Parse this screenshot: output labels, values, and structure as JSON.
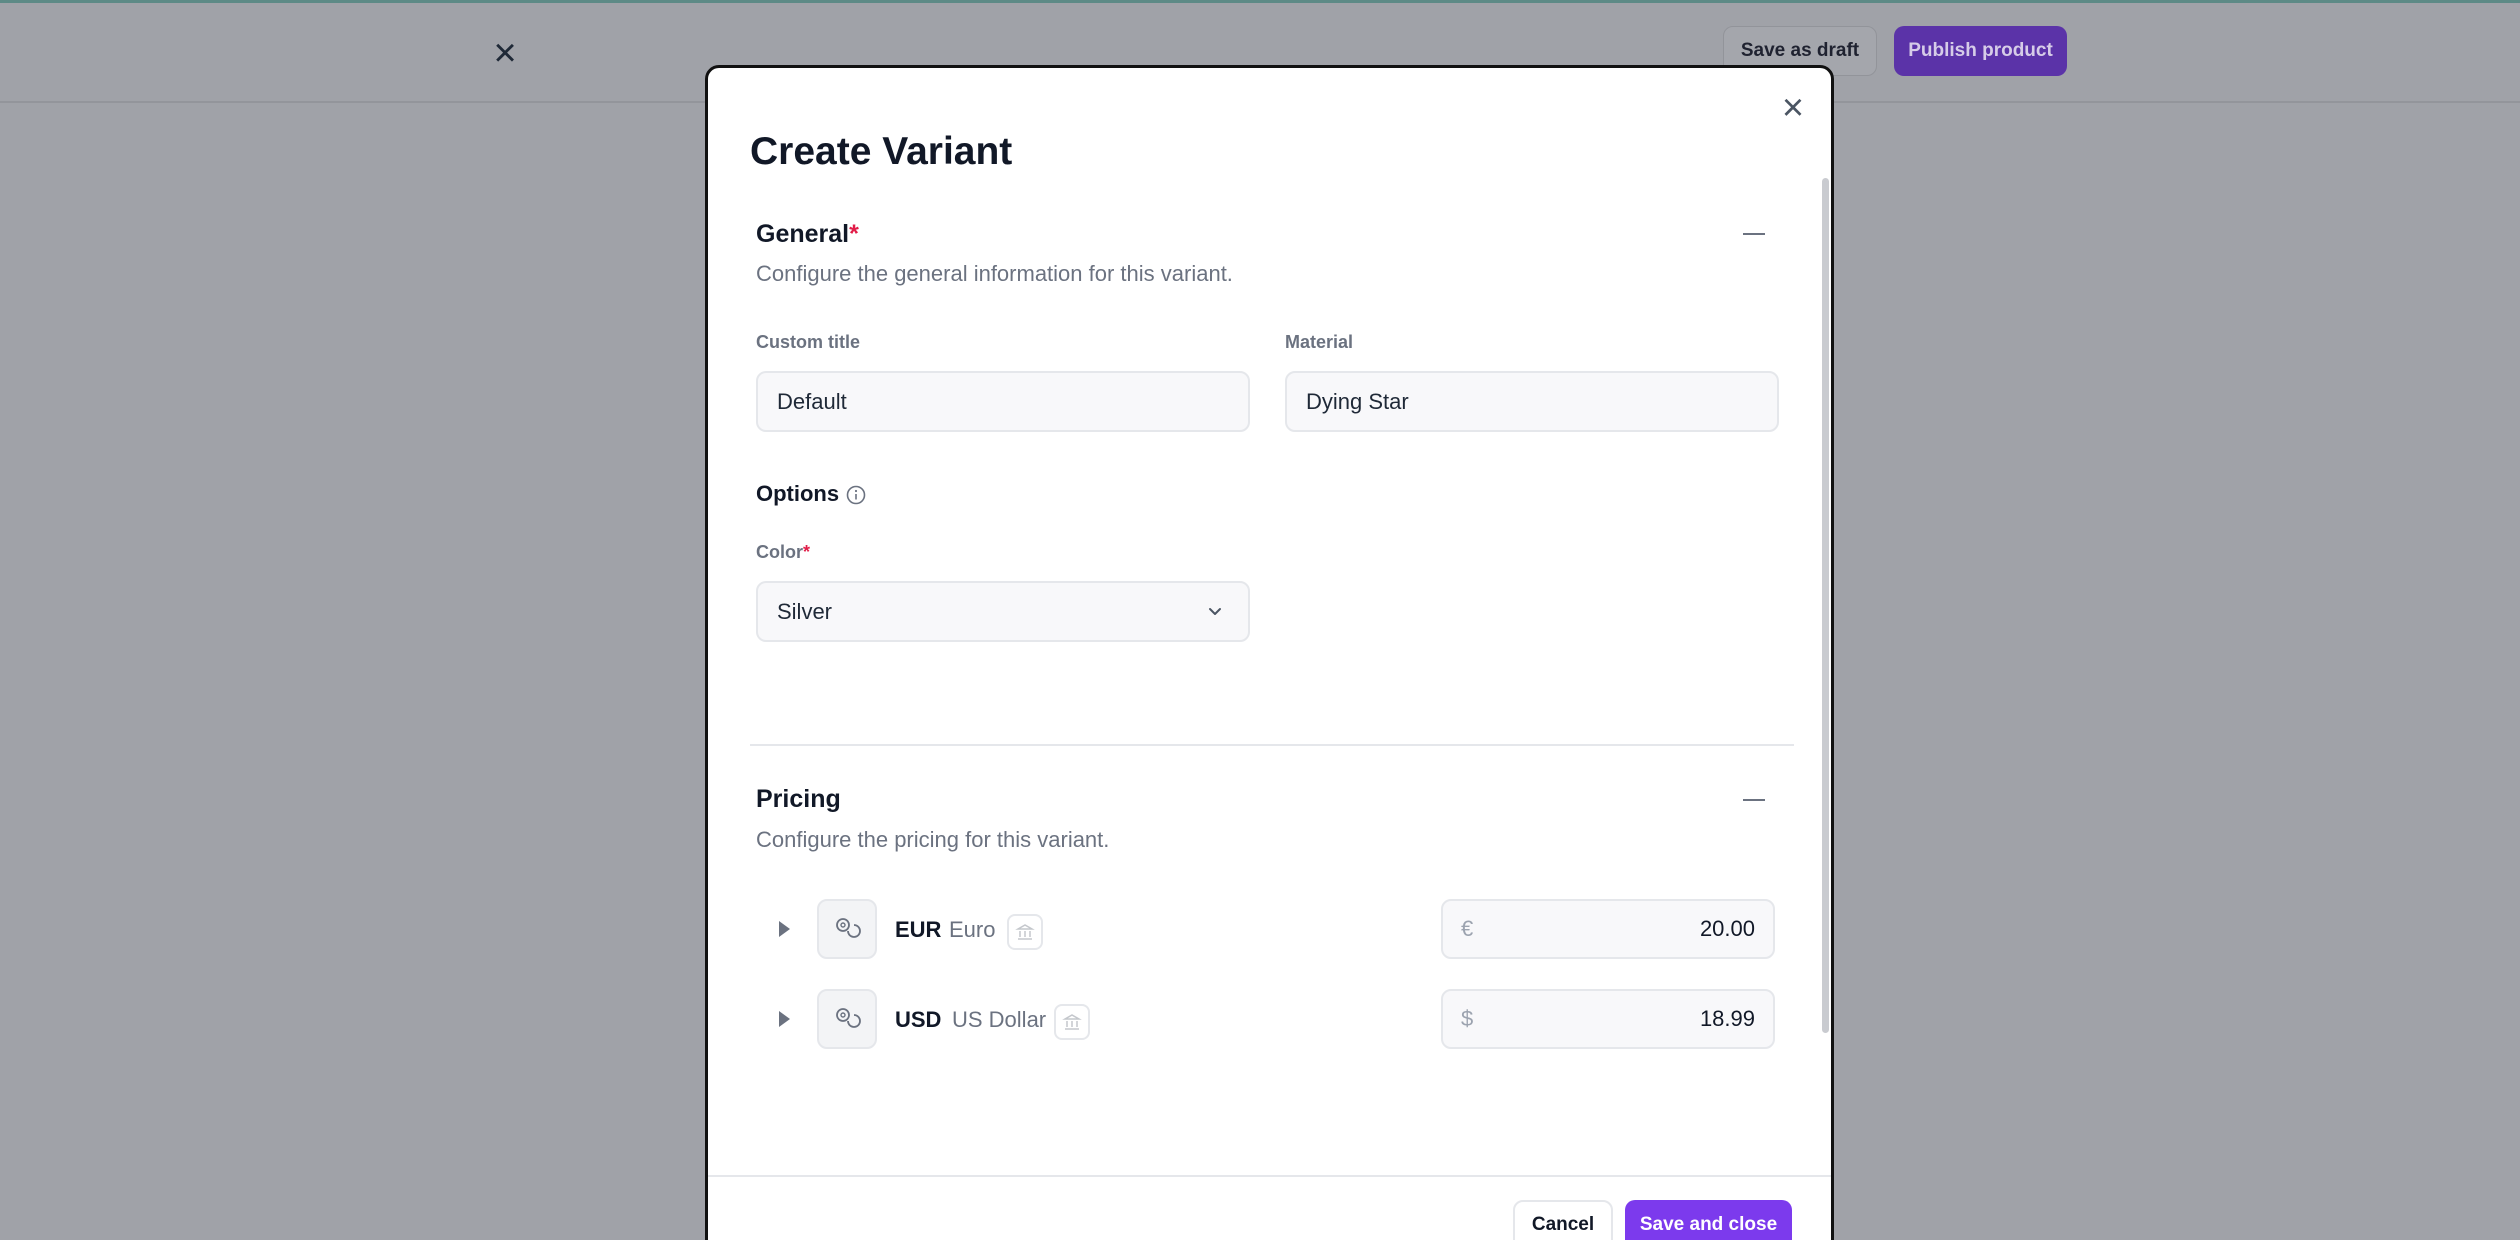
{
  "background": {
    "close_label": "×",
    "save_draft_label": "Save as draft",
    "publish_label": "Publish product"
  },
  "modal": {
    "title": "Create Variant",
    "close_label": "×",
    "general": {
      "title": "General",
      "required_mark": "*",
      "description": "Configure the general information for this variant.",
      "custom_title_label": "Custom title",
      "custom_title_value": "Default",
      "material_label": "Material",
      "material_value": "Dying Star",
      "options_title": "Options",
      "color_label": "Color",
      "color_required_mark": "*",
      "color_value": "Silver"
    },
    "pricing": {
      "title": "Pricing",
      "description": "Configure the pricing for this variant.",
      "rows": [
        {
          "code": "EUR",
          "name": "Euro",
          "symbol": "€",
          "value": "20.00"
        },
        {
          "code": "USD",
          "name": "US Dollar",
          "symbol": "$",
          "value": "18.99"
        }
      ]
    },
    "footer": {
      "cancel_label": "Cancel",
      "save_label": "Save and close"
    }
  },
  "colors": {
    "accent": "#7c3aed",
    "required": "#e11d48",
    "overlay": "#a0a2a8"
  }
}
